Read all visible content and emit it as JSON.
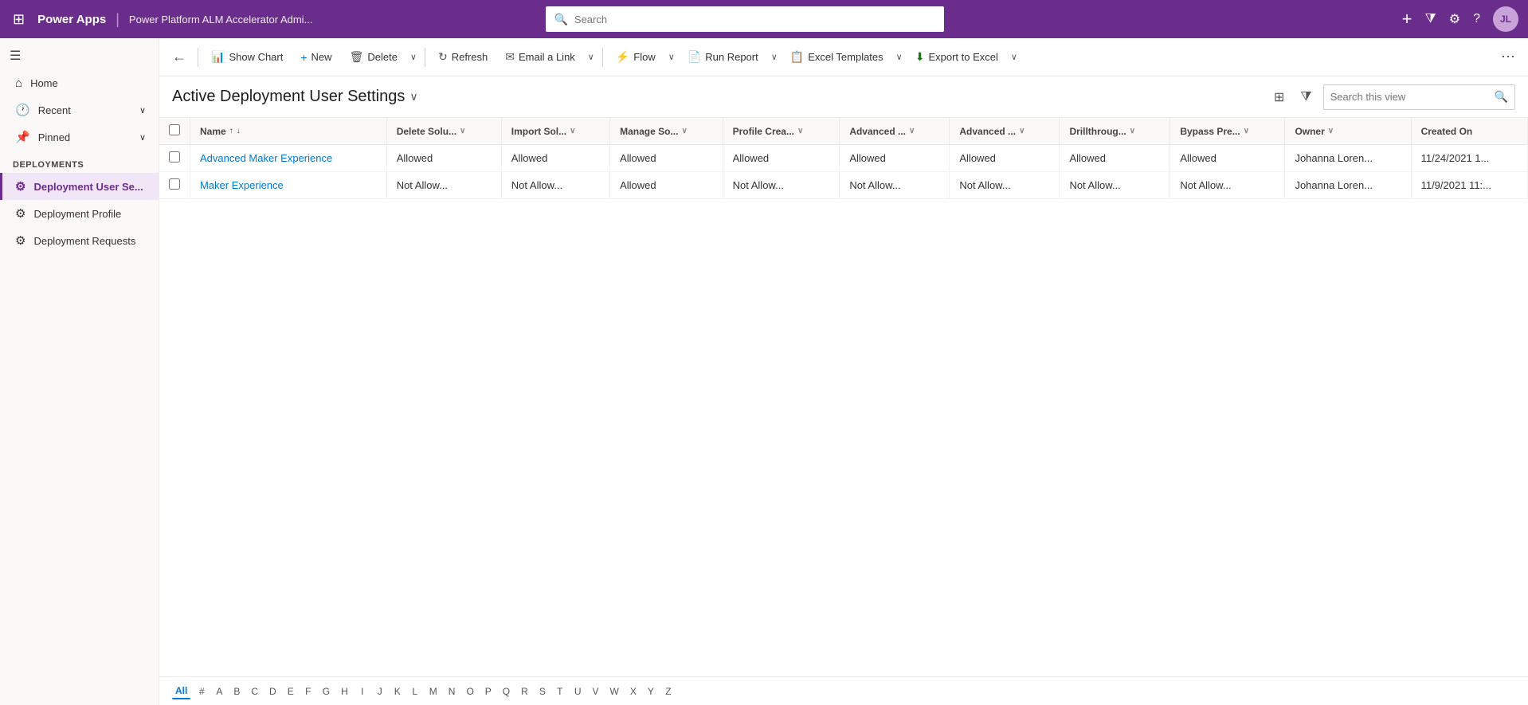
{
  "topbar": {
    "app_name": "Power Apps",
    "env_name": "Power Platform ALM Accelerator Admi...",
    "search_placeholder": "Search",
    "avatar_initials": "JL"
  },
  "sidebar": {
    "collapse_icon": "☰",
    "items": [
      {
        "id": "home",
        "label": "Home",
        "icon": "⌂",
        "active": false
      },
      {
        "id": "recent",
        "label": "Recent",
        "icon": "🕐",
        "has_chevron": true,
        "active": false
      },
      {
        "id": "pinned",
        "label": "Pinned",
        "icon": "📌",
        "has_chevron": true,
        "active": false
      }
    ],
    "section_label": "Deployments",
    "deployment_items": [
      {
        "id": "deployment-user-settings",
        "label": "Deployment User Se...",
        "icon": "⚙",
        "active": true
      },
      {
        "id": "deployment-profile",
        "label": "Deployment Profile",
        "icon": "⚙",
        "active": false
      },
      {
        "id": "deployment-requests",
        "label": "Deployment Requests",
        "icon": "⚙",
        "active": false
      }
    ]
  },
  "toolbar": {
    "back_icon": "←",
    "show_chart_label": "Show Chart",
    "new_label": "New",
    "delete_label": "Delete",
    "refresh_label": "Refresh",
    "email_link_label": "Email a Link",
    "flow_label": "Flow",
    "run_report_label": "Run Report",
    "excel_templates_label": "Excel Templates",
    "export_to_excel_label": "Export to Excel",
    "more_icon": "⋯"
  },
  "view": {
    "title": "Active Deployment User Settings",
    "search_placeholder": "Search this view"
  },
  "table": {
    "columns": [
      {
        "label": "Name",
        "key": "name",
        "sortable": true,
        "filterable": false
      },
      {
        "label": "Delete Solu...",
        "key": "delete_sol",
        "sortable": false,
        "filterable": true
      },
      {
        "label": "Import Sol...",
        "key": "import_sol",
        "sortable": false,
        "filterable": true
      },
      {
        "label": "Manage So...",
        "key": "manage_so",
        "sortable": false,
        "filterable": true
      },
      {
        "label": "Profile Crea...",
        "key": "profile_crea",
        "sortable": false,
        "filterable": true
      },
      {
        "label": "Advanced ...",
        "key": "advanced1",
        "sortable": false,
        "filterable": true
      },
      {
        "label": "Advanced ...",
        "key": "advanced2",
        "sortable": false,
        "filterable": true
      },
      {
        "label": "Drillthroug...",
        "key": "drillthrough",
        "sortable": false,
        "filterable": true
      },
      {
        "label": "Bypass Pre...",
        "key": "bypass_pre",
        "sortable": false,
        "filterable": true
      },
      {
        "label": "Owner",
        "key": "owner",
        "sortable": false,
        "filterable": true
      },
      {
        "label": "Created On",
        "key": "created_on",
        "sortable": false,
        "filterable": false
      }
    ],
    "rows": [
      {
        "name": "Advanced Maker Experience",
        "delete_sol": "Allowed",
        "import_sol": "Allowed",
        "manage_so": "Allowed",
        "profile_crea": "Allowed",
        "advanced1": "Allowed",
        "advanced2": "Allowed",
        "drillthrough": "Allowed",
        "bypass_pre": "Allowed",
        "owner": "Johanna Loren...",
        "created_on": "11/24/2021 1..."
      },
      {
        "name": "Maker Experience",
        "delete_sol": "Not Allow...",
        "import_sol": "Not Allow...",
        "manage_so": "Allowed",
        "profile_crea": "Not Allow...",
        "advanced1": "Not Allow...",
        "advanced2": "Not Allow...",
        "drillthrough": "Not Allow...",
        "bypass_pre": "Not Allow...",
        "owner": "Johanna Loren...",
        "created_on": "11/9/2021 11:..."
      }
    ]
  },
  "alpha_bar": {
    "items": [
      "All",
      "#",
      "A",
      "B",
      "C",
      "D",
      "E",
      "F",
      "G",
      "H",
      "I",
      "J",
      "K",
      "L",
      "M",
      "N",
      "O",
      "P",
      "Q",
      "R",
      "S",
      "T",
      "U",
      "V",
      "W",
      "X",
      "Y",
      "Z"
    ]
  }
}
